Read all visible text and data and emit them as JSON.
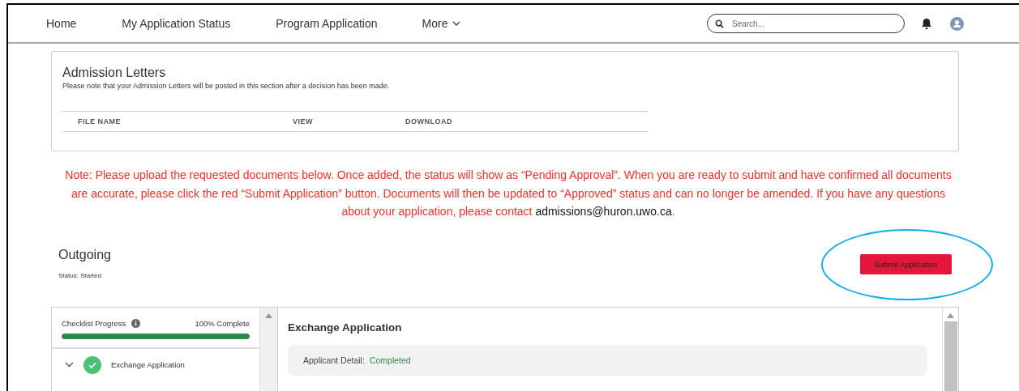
{
  "nav": {
    "items": [
      {
        "label": "Home"
      },
      {
        "label": "My Application Status"
      },
      {
        "label": "Program Application"
      },
      {
        "label": "More"
      }
    ],
    "search": {
      "placeholder": "Search..."
    }
  },
  "admission_letters": {
    "title": "Admission Letters",
    "description": "Please note that your Admission Letters will be posted in this section after a decision has been made.",
    "columns": [
      "FILE NAME",
      "VIEW",
      "DOWNLOAD"
    ]
  },
  "note": {
    "text": "Note: Please upload the requested documents below. Once added, the status will show as “Pending Approval”. When you are ready to submit and have confirmed all documents are accurate, please click the red “Submit Application” button. Documents will then be updated to “Approved” status and can no longer be amended. If you have any questions about your application, please contact",
    "email": "admissions@huron.uwo.ca",
    "end": "."
  },
  "application": {
    "title": "Outgoing",
    "status": "Status: Started",
    "submit_button": "Submit Application",
    "highlighted": true
  },
  "checklist": {
    "label": "Checklist Progress",
    "progress_text": "100% Complete",
    "level": 1.0,
    "items": [
      {
        "label": "Exchange Application",
        "expanded": true,
        "completed": true
      }
    ]
  },
  "detail": {
    "title": "Exchange Application",
    "field_label": "Applicant Detail:",
    "field_value": "Completed"
  }
}
